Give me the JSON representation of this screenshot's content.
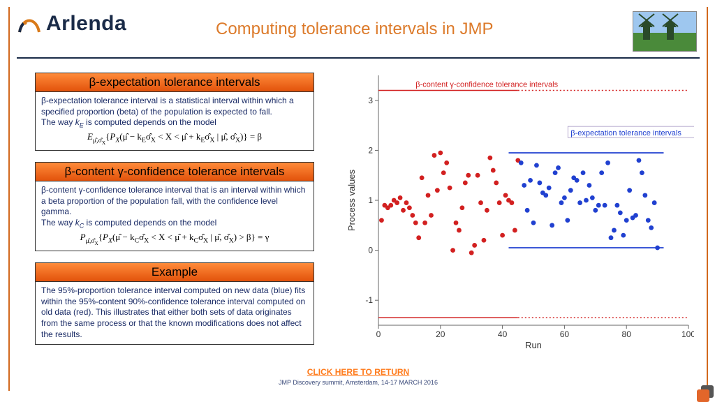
{
  "logo_text": "Arlenda",
  "title": "Computing tolerance intervals in JMP",
  "boxes": {
    "b1": {
      "header": "β-expectation tolerance intervals",
      "body": "β-expectation tolerance interval is a statistical interval within which a specified proportion (beta) of the population is expected to fall.\nThe way k_E is computed depends on the model",
      "eq": "E_{μ̂,σ̂X} { P_X( μ̂ − k_E σ̂_X < X < μ̂ + k_E σ̂_X | μ̂, σ̂_X ) } = β"
    },
    "b2": {
      "header": "β-content γ-confidence tolerance intervals",
      "body": "β-content γ-confidence tolerance interval that is an interval within which a beta proportion of the population fall, with the confidence level gamma.\nThe way k_C is computed depends on the model",
      "eq": "P_{μ̂,σ̂X} { P_X( μ̂ − k_C σ̂_X < X < μ̂ + k_C σ̂_X | μ̂, σ̂_X ) > β } = γ"
    },
    "b3": {
      "header": "Example",
      "body": "The 95%-proportion tolerance interval computed on new data (blue) fits within the 95%-content 90%-confidence tolerance interval computed on old data (red). This illustrates that either both sets of data originates from the same process or that the known modifications does not affect the results."
    }
  },
  "return_link": "CLICK HERE TO RETURN",
  "summit": "JMP Discovery summit, Amsterdam, 14-17 MARCH 2016",
  "chart_data": {
    "type": "scatter",
    "title": "",
    "xlabel": "Run",
    "ylabel": "Process values",
    "xlim": [
      0,
      100
    ],
    "ylim": [
      -1.5,
      3.5
    ],
    "xticks": [
      0,
      20,
      40,
      60,
      80,
      100
    ],
    "yticks": [
      -1,
      0,
      1,
      2,
      3
    ],
    "series": [
      {
        "name": "old data (red)",
        "color": "#d22020",
        "points": [
          [
            1,
            0.6
          ],
          [
            2,
            0.9
          ],
          [
            3,
            0.85
          ],
          [
            4,
            0.9
          ],
          [
            5,
            1.0
          ],
          [
            6,
            0.95
          ],
          [
            7,
            1.05
          ],
          [
            8,
            0.8
          ],
          [
            9,
            0.95
          ],
          [
            10,
            0.85
          ],
          [
            11,
            0.7
          ],
          [
            12,
            0.55
          ],
          [
            13,
            0.25
          ],
          [
            14,
            1.45
          ],
          [
            15,
            0.55
          ],
          [
            16,
            1.1
          ],
          [
            17,
            0.7
          ],
          [
            18,
            1.9
          ],
          [
            19,
            1.2
          ],
          [
            20,
            1.95
          ],
          [
            21,
            1.55
          ],
          [
            22,
            1.75
          ],
          [
            23,
            1.25
          ],
          [
            24,
            0.0
          ],
          [
            25,
            0.55
          ],
          [
            26,
            0.4
          ],
          [
            27,
            0.85
          ],
          [
            28,
            1.35
          ],
          [
            29,
            1.5
          ],
          [
            30,
            -0.05
          ],
          [
            31,
            0.1
          ],
          [
            32,
            1.5
          ],
          [
            33,
            0.95
          ],
          [
            34,
            0.2
          ],
          [
            35,
            0.8
          ],
          [
            36,
            1.85
          ],
          [
            37,
            1.6
          ],
          [
            38,
            1.35
          ],
          [
            39,
            0.95
          ],
          [
            40,
            0.3
          ],
          [
            41,
            1.1
          ],
          [
            42,
            1.0
          ],
          [
            43,
            0.95
          ],
          [
            44,
            0.4
          ],
          [
            45,
            1.8
          ]
        ]
      },
      {
        "name": "new data (blue)",
        "color": "#2040d0",
        "points": [
          [
            46,
            1.75
          ],
          [
            47,
            1.3
          ],
          [
            48,
            0.8
          ],
          [
            49,
            1.4
          ],
          [
            50,
            0.55
          ],
          [
            51,
            1.7
          ],
          [
            52,
            1.35
          ],
          [
            53,
            1.15
          ],
          [
            54,
            1.1
          ],
          [
            55,
            1.25
          ],
          [
            56,
            0.5
          ],
          [
            57,
            1.55
          ],
          [
            58,
            1.65
          ],
          [
            59,
            0.95
          ],
          [
            60,
            1.05
          ],
          [
            61,
            0.6
          ],
          [
            62,
            1.2
          ],
          [
            63,
            1.45
          ],
          [
            64,
            1.4
          ],
          [
            65,
            0.95
          ],
          [
            66,
            1.55
          ],
          [
            67,
            1.0
          ],
          [
            68,
            1.3
          ],
          [
            69,
            1.05
          ],
          [
            70,
            0.8
          ],
          [
            71,
            0.9
          ],
          [
            72,
            1.55
          ],
          [
            73,
            0.9
          ],
          [
            74,
            1.75
          ],
          [
            75,
            0.25
          ],
          [
            76,
            0.4
          ],
          [
            77,
            0.9
          ],
          [
            78,
            0.75
          ],
          [
            79,
            0.3
          ],
          [
            80,
            0.6
          ],
          [
            81,
            1.2
          ],
          [
            82,
            0.65
          ],
          [
            83,
            0.7
          ],
          [
            84,
            1.8
          ],
          [
            85,
            1.55
          ],
          [
            86,
            1.1
          ],
          [
            87,
            0.6
          ],
          [
            88,
            0.45
          ],
          [
            89,
            0.95
          ],
          [
            90,
            0.05
          ]
        ]
      }
    ],
    "lines": [
      {
        "kind": "content_upper",
        "y": 3.2,
        "xrange": [
          0,
          100
        ]
      },
      {
        "kind": "content_lower",
        "y": -1.35,
        "xrange": [
          0,
          100
        ]
      },
      {
        "kind": "expectation_upper",
        "y": 1.95,
        "xrange": [
          42,
          92
        ]
      },
      {
        "kind": "expectation_lower",
        "y": 0.05,
        "xrange": [
          42,
          92
        ]
      }
    ],
    "annotations": [
      {
        "text": "β-content γ-confidence tolerance intervals",
        "px": 0.12,
        "py": 0.04,
        "color": "#d22020"
      },
      {
        "text": "β-expectation tolerance intervals",
        "px": 0.62,
        "py": 0.235,
        "color": "#2040d0",
        "boxed": true
      }
    ]
  },
  "colors": {
    "red": "#d22020",
    "blue": "#2040d0",
    "orange": "#dc7a2a",
    "navy": "#1a2b66"
  }
}
